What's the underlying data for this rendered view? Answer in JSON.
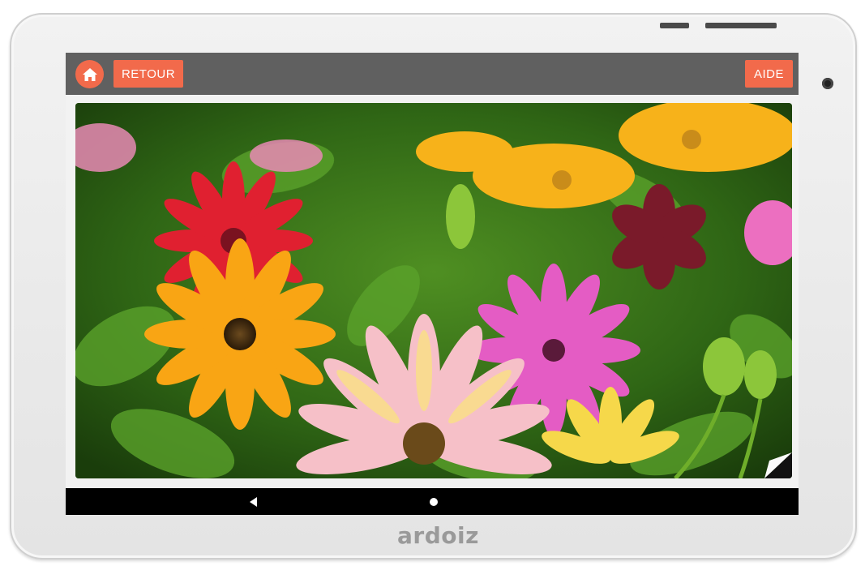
{
  "device": {
    "brand": "ardoiz"
  },
  "topbar": {
    "home_icon": "home-icon",
    "back_label": "RETOUR",
    "help_label": "AIDE",
    "accent_color": "#f26a4b",
    "bar_color": "#606060"
  },
  "content": {
    "image_subject": "photo-flowers"
  },
  "navbar": {
    "back_icon": "triangle-back-icon",
    "home_icon": "circle-home-icon"
  }
}
